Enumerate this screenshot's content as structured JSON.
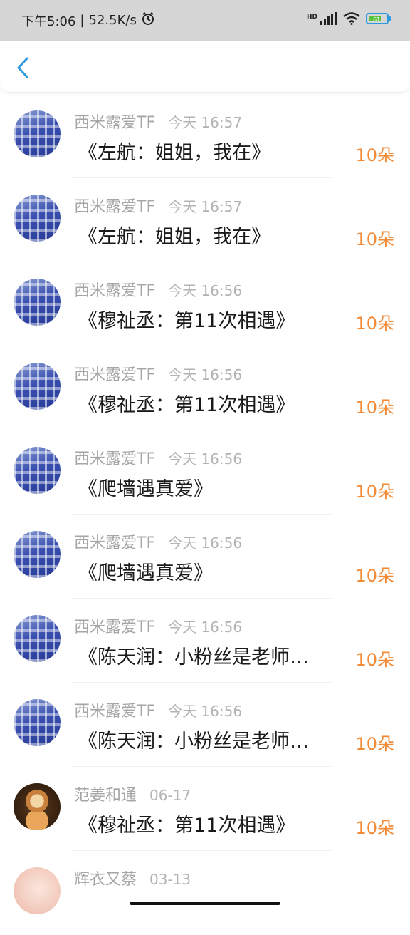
{
  "status_bar": {
    "time": "下午5:06",
    "network_speed": "52.5K/s",
    "signal_label": "HD",
    "battery_label": "61",
    "icons": [
      "alarm-icon",
      "signal-icon",
      "wifi-icon",
      "battery-icon"
    ]
  },
  "header": {
    "back_icon": "chevron-left-icon",
    "accent_color": "#2d9ae0"
  },
  "gift_list": [
    {
      "sender": "西米露爱TF",
      "time": "今天 16:57",
      "gift": "《左航：姐姐，我在》",
      "count": "10朵",
      "avatar": "blue"
    },
    {
      "sender": "西米露爱TF",
      "time": "今天 16:57",
      "gift": "《左航：姐姐，我在》",
      "count": "10朵",
      "avatar": "blue"
    },
    {
      "sender": "西米露爱TF",
      "time": "今天 16:56",
      "gift": "《穆祉丞：第11次相遇》",
      "count": "10朵",
      "avatar": "blue"
    },
    {
      "sender": "西米露爱TF",
      "time": "今天 16:56",
      "gift": "《穆祉丞：第11次相遇》",
      "count": "10朵",
      "avatar": "blue"
    },
    {
      "sender": "西米露爱TF",
      "time": "今天 16:56",
      "gift": "《爬墙遇真爱》",
      "count": "10朵",
      "avatar": "blue"
    },
    {
      "sender": "西米露爱TF",
      "time": "今天 16:56",
      "gift": "《爬墙遇真爱》",
      "count": "10朵",
      "avatar": "blue"
    },
    {
      "sender": "西米露爱TF",
      "time": "今天 16:56",
      "gift": "《陈天润：小粉丝是老师…",
      "count": "10朵",
      "avatar": "blue"
    },
    {
      "sender": "西米露爱TF",
      "time": "今天 16:56",
      "gift": "《陈天润：小粉丝是老师…",
      "count": "10朵",
      "avatar": "blue"
    },
    {
      "sender": "范姜和通",
      "time": "06-17",
      "gift": "《穆祉丞：第11次相遇》",
      "count": "10朵",
      "avatar": "brown"
    },
    {
      "sender": "辉衣又蔡",
      "time": "03-13",
      "gift": "",
      "count": "",
      "avatar": "pink"
    }
  ],
  "colors": {
    "count": "#f28a36",
    "meta": "#a6a6a6",
    "status_bar_bg": "#d6d6d6",
    "battery_fill": "#5ac23a"
  }
}
